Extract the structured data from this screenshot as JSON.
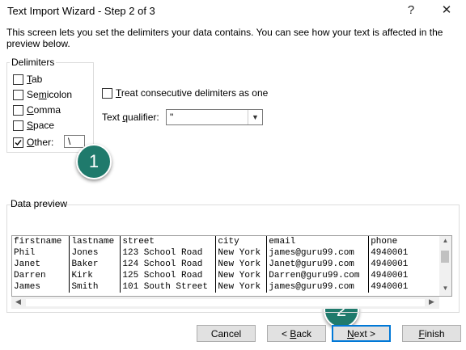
{
  "window": {
    "title": "Text Import Wizard - Step 2 of 3",
    "help_glyph": "?",
    "close_glyph": "✕"
  },
  "description": "This screen lets you set the delimiters your data contains.  You can see how your text is affected in the preview below.",
  "delimiters": {
    "group_label": "Delimiters",
    "options": [
      {
        "pre": "",
        "key": "T",
        "post": "ab",
        "checked": false
      },
      {
        "pre": "Se",
        "key": "m",
        "post": "icolon",
        "checked": false
      },
      {
        "pre": "",
        "key": "C",
        "post": "omma",
        "checked": false
      },
      {
        "pre": "",
        "key": "S",
        "post": "pace",
        "checked": false
      },
      {
        "pre": "",
        "key": "O",
        "post": "ther:",
        "checked": true
      }
    ],
    "other_value": "\\"
  },
  "consecutive": {
    "pre": "",
    "key": "T",
    "post": "reat consecutive delimiters as one",
    "checked": false
  },
  "qualifier": {
    "pre": "Text ",
    "key": "q",
    "post": "ualifier:",
    "value": "\""
  },
  "annotations": {
    "badge1": "1",
    "badge2": "2",
    "color": "#1f7a6c"
  },
  "preview": {
    "label": "Data preview",
    "rows": [
      [
        "firstname",
        "lastname",
        "street",
        "city",
        "email",
        "phone"
      ],
      [
        "Phil",
        "Jones",
        "123 School Road",
        "New York",
        "james@guru99.com",
        "4940001"
      ],
      [
        "Janet",
        "Baker",
        "124 School Road",
        "New York",
        "Janet@guru99.com",
        "4940001"
      ],
      [
        "Darren",
        "Kirk",
        "125 School Road",
        "New York",
        "Darren@guru99.com",
        "4940001"
      ],
      [
        "James",
        "Smith",
        "101 South Street",
        "New York",
        "james@guru99.com",
        "4940001"
      ]
    ]
  },
  "buttons": {
    "cancel": "Cancel",
    "back": {
      "pre": "< ",
      "key": "B",
      "post": "ack"
    },
    "next": {
      "pre": "",
      "key": "N",
      "post": "ext >"
    },
    "finish": {
      "pre": "",
      "key": "F",
      "post": "inish"
    }
  }
}
